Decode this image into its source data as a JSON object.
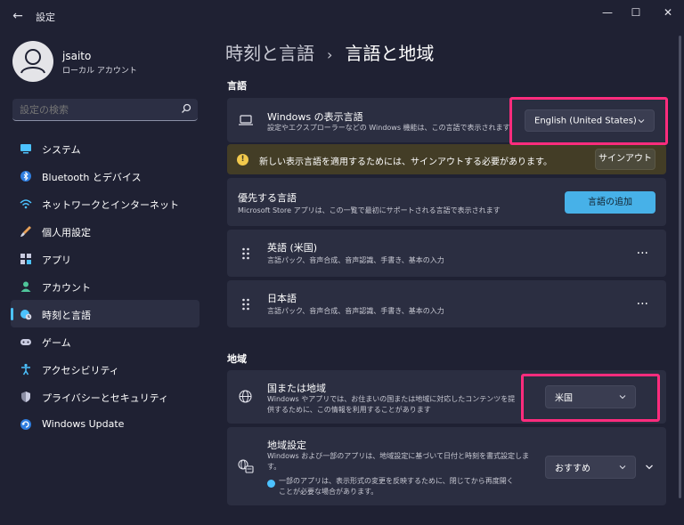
{
  "window": {
    "title": "設定",
    "back": "←",
    "minimize": "—",
    "maximize": "☐",
    "close": "✕"
  },
  "user": {
    "name": "jsaito",
    "account_type": "ローカル アカウント"
  },
  "search": {
    "placeholder": "設定の検索"
  },
  "sidebar": {
    "items": [
      {
        "label": "システム",
        "icon": "monitor-icon"
      },
      {
        "label": "Bluetooth とデバイス",
        "icon": "bluetooth-icon"
      },
      {
        "label": "ネットワークとインターネット",
        "icon": "wifi-icon"
      },
      {
        "label": "個人用設定",
        "icon": "brush-icon"
      },
      {
        "label": "アプリ",
        "icon": "apps-icon"
      },
      {
        "label": "アカウント",
        "icon": "person-icon"
      },
      {
        "label": "時刻と言語",
        "icon": "globe-clock-icon",
        "active": true
      },
      {
        "label": "ゲーム",
        "icon": "gamepad-icon"
      },
      {
        "label": "アクセシビリティ",
        "icon": "accessibility-icon"
      },
      {
        "label": "プライバシーとセキュリティ",
        "icon": "shield-icon"
      },
      {
        "label": "Windows Update",
        "icon": "update-icon"
      }
    ]
  },
  "breadcrumb": {
    "parent": "時刻と言語",
    "separator": "›",
    "current": "言語と地域"
  },
  "language_section": {
    "title": "言語",
    "display_language": {
      "title": "Windows の表示言語",
      "description": "設定やエクスプローラーなどの Windows 機能は、この言語で表示されます。",
      "value": "English (United States)"
    },
    "warning": {
      "text": "新しい表示言語を適用するためには、サインアウトする必要があります。",
      "button": "サインアウト"
    },
    "preferred": {
      "title": "優先する言語",
      "description": "Microsoft Store アプリは、この一覧で最初にサポートされる言語で表示されます",
      "button": "言語の追加"
    },
    "languages": [
      {
        "name": "英語 (米国)",
        "features": "言語パック、音声合成、音声認識、手書き、基本の入力"
      },
      {
        "name": "日本語",
        "features": "言語パック、音声合成、音声認識、手書き、基本の入力"
      }
    ],
    "more": "···"
  },
  "region_section": {
    "title": "地域",
    "country": {
      "title": "国または地域",
      "description": "Windows やアプリでは、お住まいの国または地域に対応したコンテンツを提供するために、この情報を利用することがあります",
      "value": "米国"
    },
    "format": {
      "title": "地域設定",
      "description": "Windows および一部のアプリは、地域設定に基づいて日付と時刻を書式設定します。",
      "note": "一部のアプリは、表示形式の変更を反映するために、閉じてから再度開くことが必要な場合があります。",
      "value": "おすすめ"
    }
  },
  "colors": {
    "accent": "#4cc2ff",
    "highlight": "#ff2c7d",
    "warning": "#f2c94c"
  }
}
